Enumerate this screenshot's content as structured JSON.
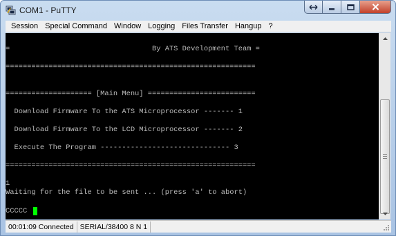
{
  "window": {
    "title": "COM1 - PuTTY"
  },
  "menu": [
    "Session",
    "Special Command",
    "Window",
    "Logging",
    "Files Transfer",
    "Hangup",
    "?"
  ],
  "terminal": {
    "lines": [
      "=                                 By ATS Development Team =",
      "",
      "==========================================================",
      "",
      "",
      "==================== [Main Menu] =========================",
      "",
      "  Download Firmware To the ATS Microprocessor ------- 1",
      "",
      "  Download Firmware To the LCD Microprocessor ------- 2",
      "",
      "  Execute The Program ------------------------------ 3",
      "",
      "==========================================================",
      "",
      "",
      "1",
      "Waiting for the file to be sent ... (press 'a' to abort)",
      "",
      "CCCCC"
    ],
    "cursor_color": "#00ff00"
  },
  "status": {
    "time": "00:01:09 Connected",
    "port": "SERIAL/38400 8 N 1"
  }
}
